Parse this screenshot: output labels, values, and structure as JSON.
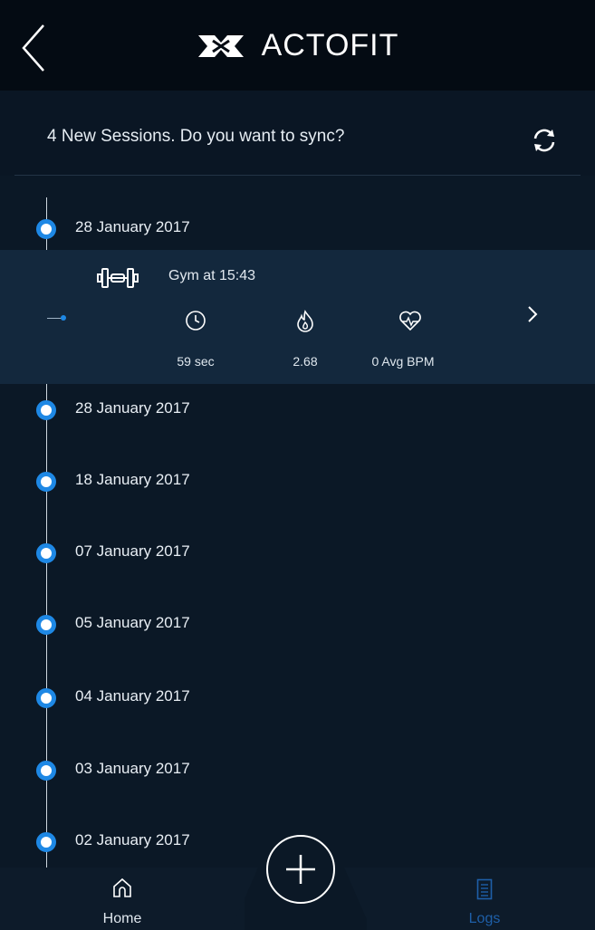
{
  "header": {
    "title": "ACTOFIT",
    "back_icon": "chevron-left-icon",
    "logo_icon": "actofit-logo-icon"
  },
  "sync": {
    "message": "4 New Sessions. Do you want to sync?",
    "icon": "sync-icon"
  },
  "timeline": {
    "first_date": "28 January 2017",
    "session": {
      "title": "Gym at 15:43",
      "icon": "dumbbell-icon",
      "duration": "59 sec",
      "duration_icon": "clock-icon",
      "calories": "2.68",
      "calories_icon": "flame-icon",
      "heart_rate": "0 Avg BPM",
      "heart_rate_icon": "heart-rate-icon",
      "open_icon": "chevron-right-icon"
    },
    "dates": [
      "28 January 2017",
      "18 January 2017",
      "07 January 2017",
      "05 January 2017",
      "04 January 2017",
      "03 January 2017",
      "02 January 2017"
    ]
  },
  "tabbar": {
    "home_label": "Home",
    "logs_label": "Logs",
    "add_icon": "plus-icon",
    "accent_color": "#1e88e5"
  }
}
